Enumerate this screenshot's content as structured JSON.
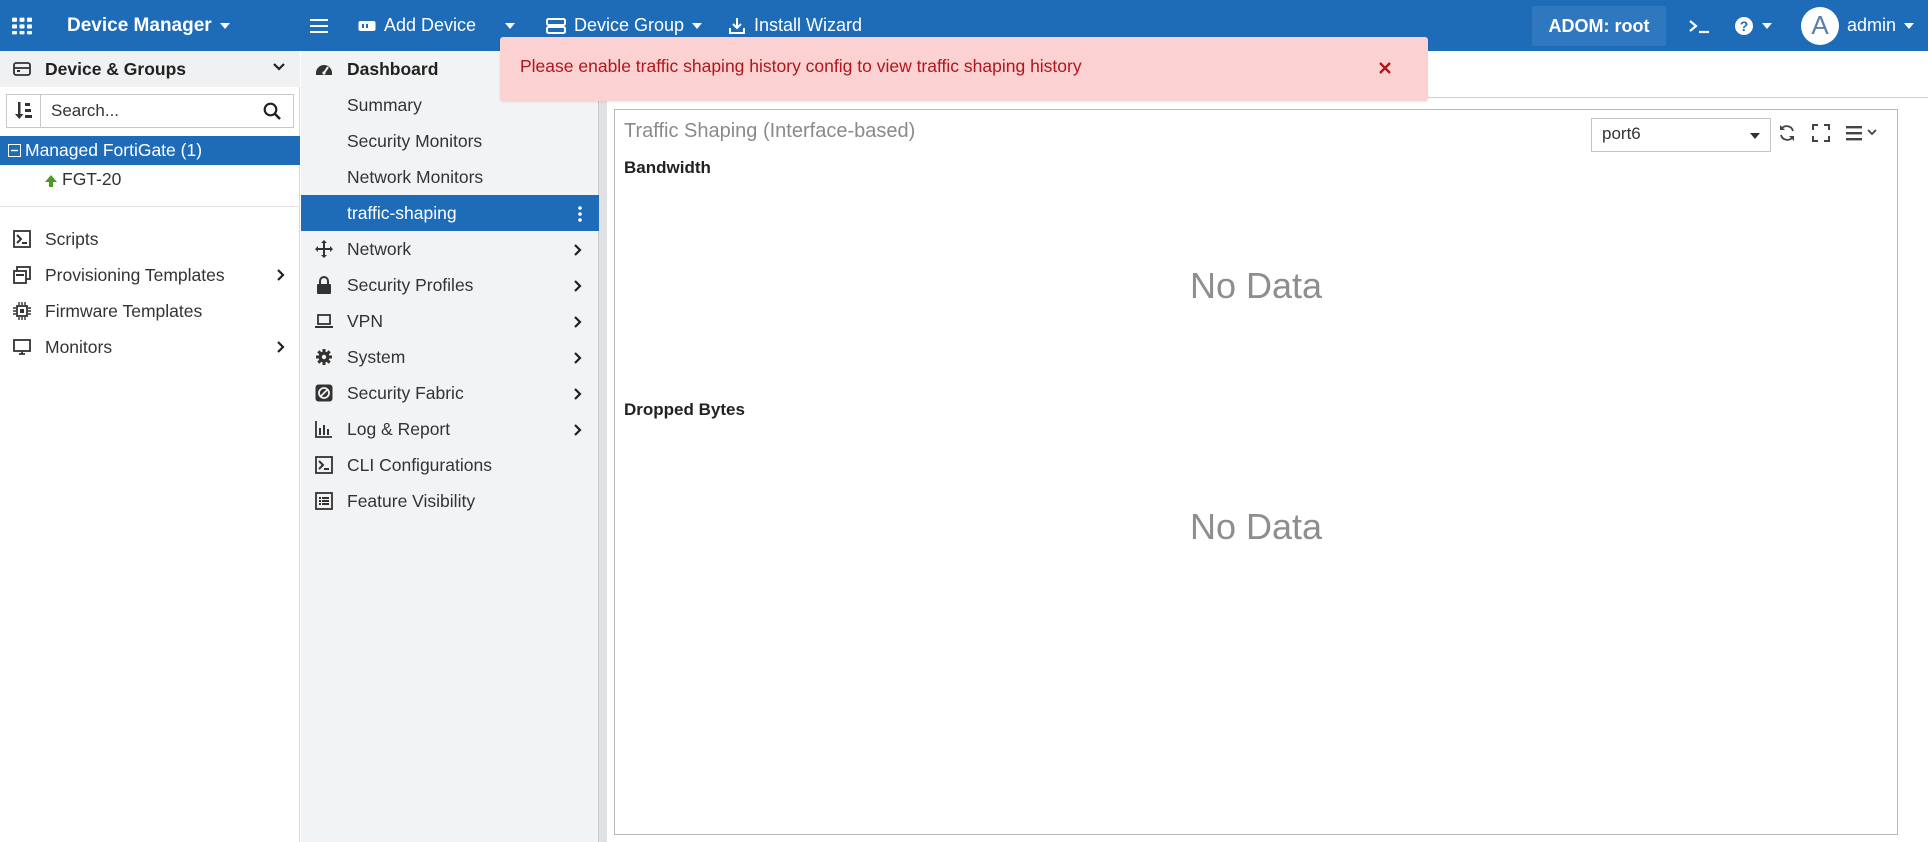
{
  "topbar": {
    "app_title": "Device Manager",
    "add_device": "Add Device",
    "device_group": "Device Group",
    "install_wizard": "Install Wizard",
    "adom": "ADOM: root",
    "avatar_letter": "A",
    "user": "admin",
    "icons": [
      "apps-grid-icon",
      "hamburger-icon",
      "add-device-icon",
      "device-group-icon",
      "install-icon",
      "terminal-icon",
      "help-icon"
    ]
  },
  "left": {
    "header": "Device & Groups",
    "search_placeholder": "Search...",
    "group": "Managed FortiGate (1)",
    "device": "FGT-20",
    "items": [
      {
        "label": "Scripts",
        "icon": "script-icon",
        "expandable": false
      },
      {
        "label": "Provisioning Templates",
        "icon": "template-icon",
        "expandable": true
      },
      {
        "label": "Firmware Templates",
        "icon": "chip-icon",
        "expandable": false
      },
      {
        "label": "Monitors",
        "icon": "monitor-icon",
        "expandable": true
      }
    ]
  },
  "menu": {
    "items": [
      {
        "label": "Dashboard",
        "icon": "dashboard-icon",
        "type": "header"
      },
      {
        "label": "Summary",
        "type": "sub"
      },
      {
        "label": "Security Monitors",
        "type": "sub"
      },
      {
        "label": "Network Monitors",
        "type": "sub"
      },
      {
        "label": "traffic-shaping",
        "type": "active"
      },
      {
        "label": "Network",
        "icon": "network-icon",
        "expandable": true
      },
      {
        "label": "Security Profiles",
        "icon": "lock-icon",
        "expandable": true
      },
      {
        "label": "VPN",
        "icon": "laptop-icon",
        "expandable": true
      },
      {
        "label": "System",
        "icon": "gear-icon",
        "expandable": true
      },
      {
        "label": "Security Fabric",
        "icon": "fabric-icon",
        "expandable": true
      },
      {
        "label": "Log & Report",
        "icon": "chart-icon",
        "expandable": true
      },
      {
        "label": "CLI Configurations",
        "icon": "cli-icon",
        "expandable": false
      },
      {
        "label": "Feature Visibility",
        "icon": "list-icon",
        "expandable": false
      }
    ]
  },
  "alert": {
    "message": "Please enable traffic shaping history config to view traffic shaping history"
  },
  "widget": {
    "title": "Traffic Shaping (Interface-based)",
    "port": "port6",
    "sections": [
      {
        "title": "Bandwidth",
        "empty_text": "No Data"
      },
      {
        "title": "Dropped Bytes",
        "empty_text": "No Data"
      }
    ]
  },
  "colors": {
    "topbar": "#1e6bb8",
    "active": "#1e6bb8",
    "alert_bg": "#fcd1d1",
    "alert_text": "#b0161b",
    "device_up": "#4c9a2a"
  }
}
